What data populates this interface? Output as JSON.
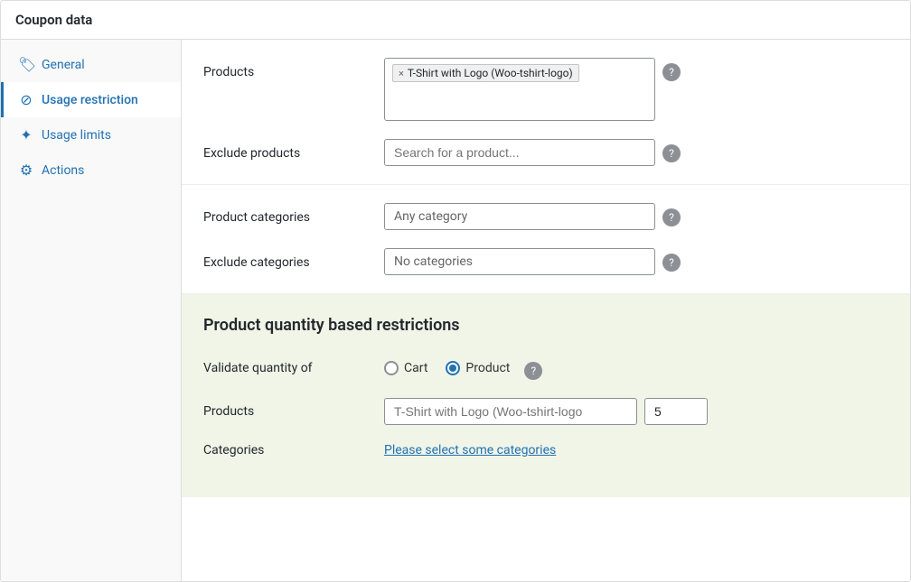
{
  "title": "Coupon data",
  "sidebar": {
    "items": [
      {
        "id": "general",
        "label": "General",
        "icon": "🏷",
        "active": false
      },
      {
        "id": "usage-restriction",
        "label": "Usage restriction",
        "icon": "⊘",
        "active": true
      },
      {
        "id": "usage-limits",
        "label": "Usage limits",
        "icon": "✦",
        "active": false
      },
      {
        "id": "actions",
        "label": "Actions",
        "icon": "⚙",
        "active": false
      }
    ]
  },
  "form": {
    "products_label": "Products",
    "products_tag": "T-Shirt with Logo (Woo-tshirt-logo)",
    "exclude_products_label": "Exclude products",
    "exclude_products_placeholder": "Search for a product...",
    "product_categories_label": "Product categories",
    "product_categories_placeholder": "Any category",
    "exclude_categories_label": "Exclude categories",
    "exclude_categories_placeholder": "No categories"
  },
  "quantity_section": {
    "title": "Product quantity based restrictions",
    "validate_label": "Validate quantity of",
    "radio_cart": "Cart",
    "radio_product": "Product",
    "products_label": "Products",
    "products_placeholder": "T-Shirt with Logo (Woo-tshirt-logo",
    "products_value": "5",
    "categories_label": "Categories",
    "categories_link": "Please select some categories"
  }
}
